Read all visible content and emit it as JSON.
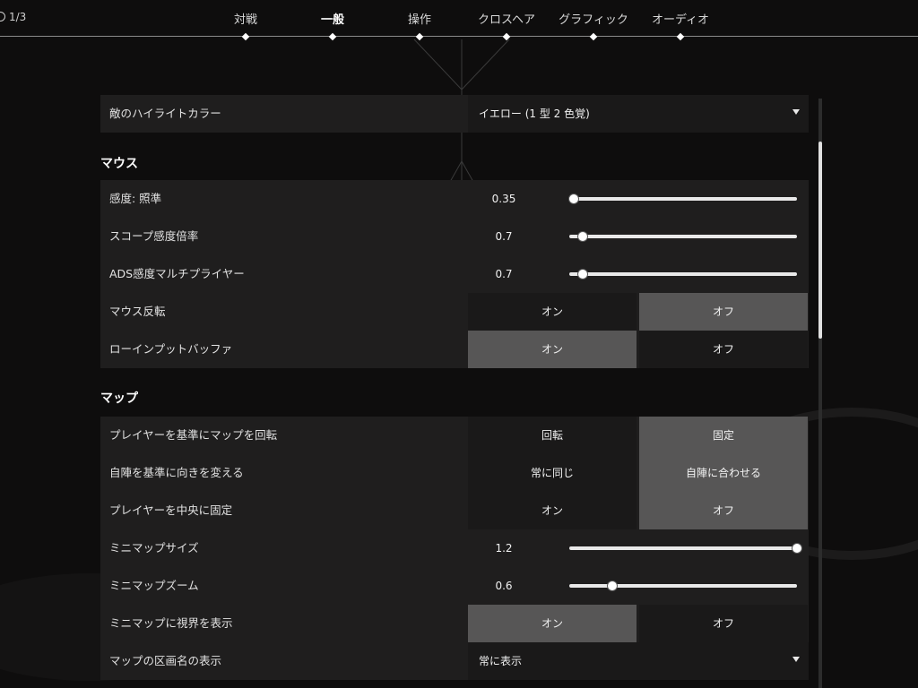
{
  "page_indicator": "1/3",
  "tabs": [
    {
      "label": "対戦",
      "active": false
    },
    {
      "label": "一般",
      "active": true
    },
    {
      "label": "操作",
      "active": false
    },
    {
      "label": "クロスヘア",
      "active": false
    },
    {
      "label": "グラフィック",
      "active": false
    },
    {
      "label": "オーディオ",
      "active": false
    }
  ],
  "enemy_highlight": {
    "label": "敵のハイライトカラー",
    "value": "イエロー (1 型 2 色覚)"
  },
  "sections": {
    "mouse": "マウス",
    "map": "マップ"
  },
  "mouse": {
    "sensitivity": {
      "label": "感度: 照準",
      "value": "0.35",
      "fraction": 0.02
    },
    "scope_sensitivity": {
      "label": "スコープ感度倍率",
      "value": "0.7",
      "fraction": 0.06
    },
    "ads_multiplier": {
      "label": "ADS感度マルチプライヤー",
      "value": "0.7",
      "fraction": 0.06
    },
    "invert": {
      "label": "マウス反転",
      "on": "オン",
      "off": "オフ",
      "selected": "off"
    },
    "raw_input": {
      "label": "ローインプットバッファ",
      "on": "オン",
      "off": "オフ",
      "selected": "on"
    }
  },
  "map": {
    "rotate": {
      "label": "プレイヤーを基準にマップを回転",
      "on": "回転",
      "off": "固定",
      "selected": "off"
    },
    "orientation": {
      "label": "自陣を基準に向きを変える",
      "on": "常に同じ",
      "off": "自陣に合わせる",
      "selected": "off"
    },
    "center": {
      "label": "プレイヤーを中央に固定",
      "on": "オン",
      "off": "オフ",
      "selected": "off"
    },
    "minimap_size": {
      "label": "ミニマップサイズ",
      "value": "1.2",
      "fraction": 1.0
    },
    "minimap_zoom": {
      "label": "ミニマップズーム",
      "value": "0.6",
      "fraction": 0.19
    },
    "minimap_vision": {
      "label": "ミニマップに視界を表示",
      "on": "オン",
      "off": "オフ",
      "selected": "on"
    },
    "region_names": {
      "label": "マップの区画名の表示",
      "value": "常に表示"
    }
  },
  "colors": {
    "background": "#0e0d0d",
    "row": "#1f1e1e",
    "selected": "#575656",
    "accent": "#ffffff"
  }
}
